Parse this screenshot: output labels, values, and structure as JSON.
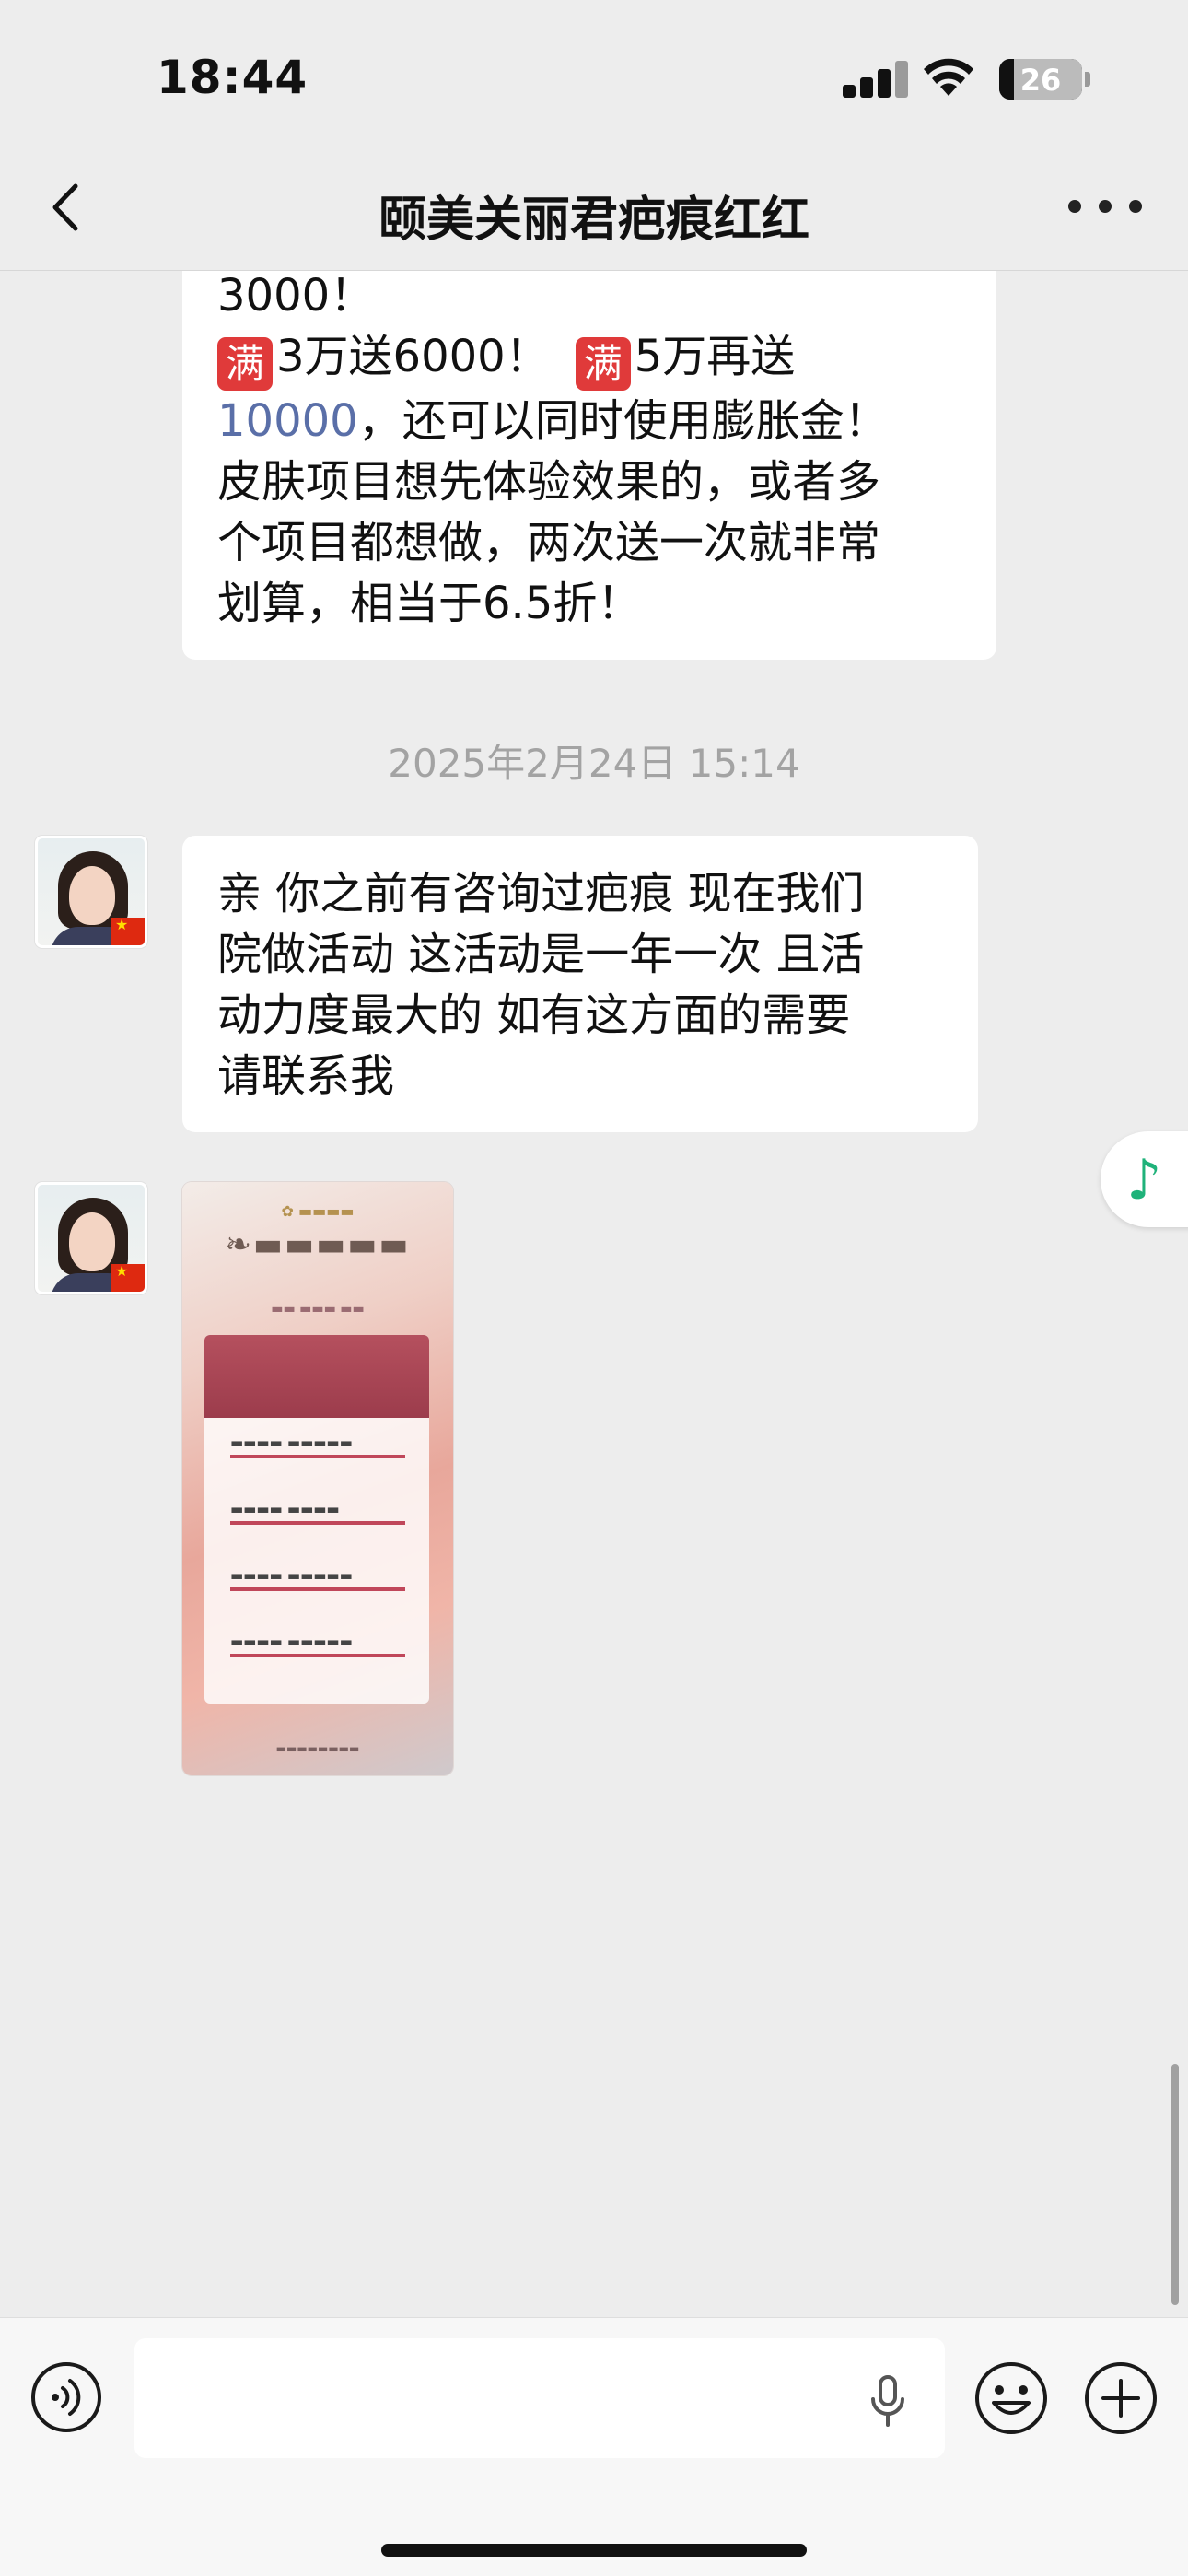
{
  "status_bar": {
    "time": "18:44",
    "battery": "26"
  },
  "nav": {
    "title": "颐美关丽君疤痕红红"
  },
  "messages": {
    "promo": {
      "line1": "3000！",
      "line2_tag1": "满",
      "line2_a": "3万送6000！",
      "line2_tag2": "满",
      "line2_b": "5万再送",
      "line3_link": "10000",
      "line3_rest": "，还可以同时使用膨胀金！",
      "line4": "皮肤项目想先体验效果的，或者多",
      "line5": "个项目都想做，两次送一次就非常",
      "line6": "划算，相当于6.5折！"
    },
    "timestamp": "2025年2月24日 15:14",
    "consult": {
      "line1": "亲 你之前有咨询过疤痕 现在我们",
      "line2": "院做活动 这活动是一年一次 且活",
      "line3": "动力度最大的  如有这方面的需要",
      "line4": "请联系我"
    }
  },
  "colors": {
    "background": "#ededed",
    "bubble": "#ffffff",
    "link": "#5a6fa8",
    "tag": "#e03a3a",
    "music_accent": "#1fb27a"
  },
  "icons": {
    "back": "chevron-left-icon",
    "more": "more-dots-icon",
    "voice": "voice-icon",
    "mic": "microphone-icon",
    "emoji": "emoji-icon",
    "plus": "plus-icon",
    "music": "music-note-icon"
  }
}
